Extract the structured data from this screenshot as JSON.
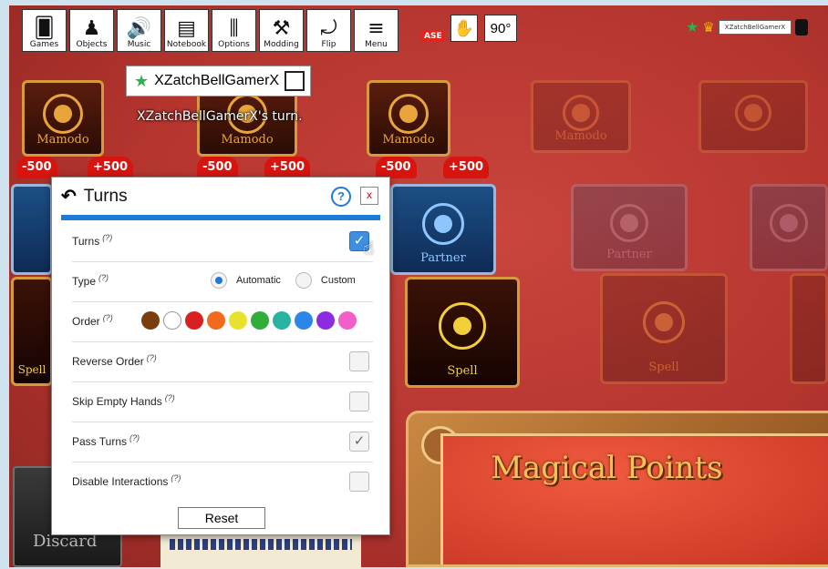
{
  "toolbar": {
    "buttons": [
      {
        "label": "Games",
        "icon": "games-icon",
        "glyph": "🂠"
      },
      {
        "label": "Objects",
        "icon": "objects-icon",
        "glyph": "♟"
      },
      {
        "label": "Music",
        "icon": "music-icon",
        "glyph": "🔊"
      },
      {
        "label": "Notebook",
        "icon": "notebook-icon",
        "glyph": "▤"
      },
      {
        "label": "Options",
        "icon": "options-icon",
        "glyph": "⫼"
      },
      {
        "label": "Modding",
        "icon": "modding-icon",
        "glyph": "⚒"
      },
      {
        "label": "Flip",
        "icon": "flip-icon",
        "glyph": "⤾"
      },
      {
        "label": "Menu",
        "icon": "menu-icon",
        "glyph": "≡"
      }
    ],
    "release_tag": "ASE",
    "rotation": "90°"
  },
  "player": {
    "name": "XZatchBellGamerX",
    "turn_message": "XZatchBellGamerX's turn."
  },
  "cards": {
    "mamodo": "Mamodo",
    "partner": "Partner",
    "spell": "Spell",
    "discard": "Discard",
    "minus": "-500",
    "plus": "+500"
  },
  "board": {
    "title": "Magical Points"
  },
  "turns_panel": {
    "title": "Turns",
    "help": "?",
    "close": "x",
    "rows": {
      "turns": {
        "label": "Turns",
        "hint": "(?)",
        "checked": true
      },
      "type": {
        "label": "Type",
        "hint": "(?)",
        "automatic": "Automatic",
        "custom": "Custom",
        "selected": "Automatic"
      },
      "order": {
        "label": "Order",
        "hint": "(?)"
      },
      "reverse": {
        "label": "Reverse Order",
        "hint": "(?)",
        "checked": false
      },
      "skip": {
        "label": "Skip Empty Hands",
        "hint": "(?)",
        "checked": false
      },
      "pass": {
        "label": "Pass Turns",
        "hint": "(?)",
        "checked": true
      },
      "disable": {
        "label": "Disable Interactions",
        "hint": "(?)",
        "checked": false
      }
    },
    "order_colors": [
      "#7a3d0f",
      "#ffffff",
      "#d91f1f",
      "#f26a1b",
      "#e6e22e",
      "#2fae3a",
      "#26b3a0",
      "#2b86e8",
      "#8b2be2",
      "#f25fc9"
    ],
    "reset": "Reset"
  }
}
